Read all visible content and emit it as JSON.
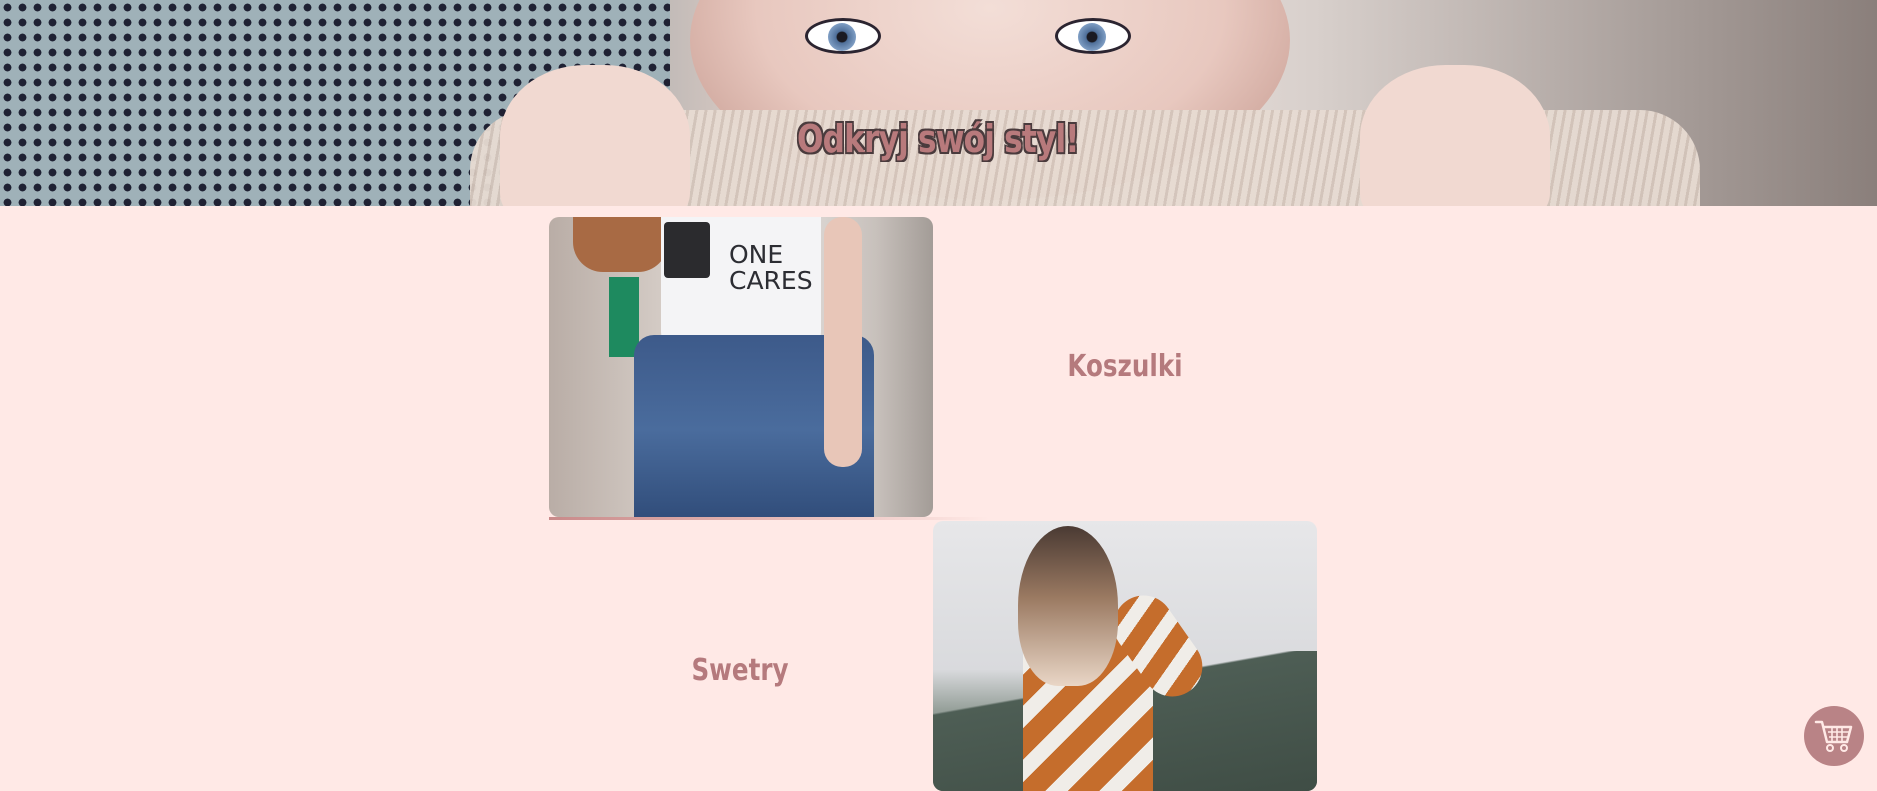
{
  "hero": {
    "title": "Odkryj swój styl!"
  },
  "categories": [
    {
      "label": "Koszulki",
      "image_alt": "koszulki-photo"
    },
    {
      "label": "Swetry",
      "image_alt": "swetry-photo"
    }
  ],
  "shirt_print": "ONE\nCARES",
  "cart": {
    "icon": "shopping-cart-icon"
  },
  "colors": {
    "background": "#ffe9e6",
    "accent": "#b57a7d",
    "cart_button": "#b98386"
  }
}
